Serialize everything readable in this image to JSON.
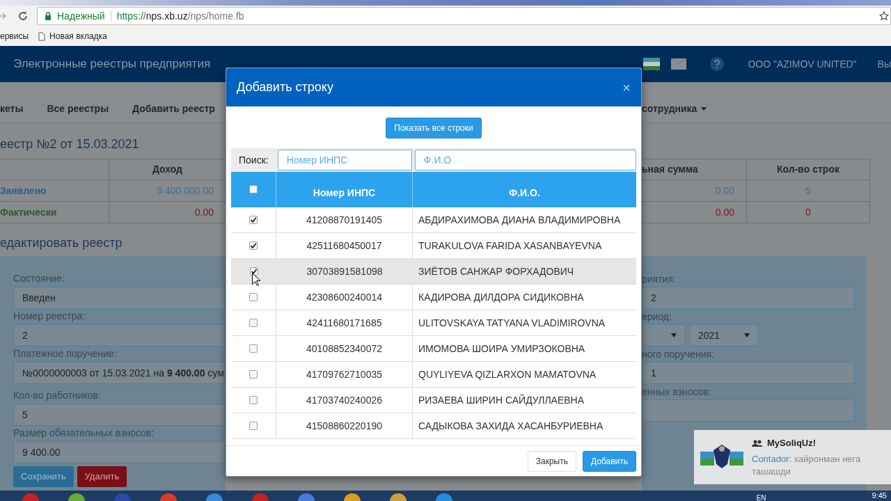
{
  "browser": {
    "security_label": "Надежный",
    "url_scheme": "https://",
    "url_host": "nps.xb.uz",
    "url_path": "/nps/home.fb",
    "bookmarks": [
      {
        "label": "ервисы",
        "kind": "folder"
      },
      {
        "label": "Новая вкладка",
        "kind": "page"
      }
    ]
  },
  "header": {
    "title": "Электронные реестры предприятия",
    "company": "ООО \"AZIMOV UNITED\"",
    "logout": "Вы"
  },
  "nav": {
    "left": [
      "кеты",
      "Все реестры",
      "Добавить реестр"
    ],
    "right": "сотрудника"
  },
  "registry_title": "еестр №2 от 15.03.2021",
  "summary": {
    "left_columns": [
      "",
      "Доход"
    ],
    "right_columns": [
      "ьная сумма",
      "Кол-во строк"
    ],
    "rows": [
      {
        "label": "Заявлено",
        "kind": "declared",
        "income": "9 400 000.00",
        "sum": "0.00",
        "count": "5"
      },
      {
        "label": "Фактически",
        "kind": "actual",
        "income": "0.00",
        "sum": "0.00",
        "count": "0"
      }
    ]
  },
  "edit_title": "едактировать реестр",
  "form_left": [
    {
      "label": "Состояние:",
      "value": "Введен"
    },
    {
      "label": "Номер реестра:",
      "value": "2"
    },
    {
      "label": "Платежное поручение:",
      "value": "№0000000003 от 15.03.2021 на **9 400.00** сум"
    },
    {
      "label": "Кол-во работников:",
      "value": "5"
    },
    {
      "label": "Размер обязательных взносов:",
      "value": "9 400.00"
    }
  ],
  "form_right": [
    {
      "label": "риятия:",
      "kind": "text",
      "value": "2"
    },
    {
      "label": "ериод:",
      "kind": "selects",
      "year": "2021"
    },
    {
      "label": "ного поручения:",
      "kind": "text",
      "value": "1"
    },
    {
      "label": "енных взносов:",
      "kind": "text"
    }
  ],
  "form_buttons": [
    {
      "label": "Сохранить",
      "kind": "primary"
    },
    {
      "label": "Удалить",
      "kind": "danger"
    }
  ],
  "modal": {
    "title": "Добавить строку",
    "close": "×",
    "show_all": "Показать все строки",
    "search_label": "Поиск:",
    "search_inps_placeholder": "Номер ИНПС",
    "search_name_placeholder": "Ф.И.О",
    "columns": [
      "Номер ИНПС",
      "Ф.И.О."
    ],
    "all_checked": false,
    "rows": [
      {
        "inps": "41208870191405",
        "name": "АБДИРАХИМОВА ДИАНА ВЛАДИМИРОВНА",
        "checked": true,
        "hovered": false
      },
      {
        "inps": "42511680450017",
        "name": "TURAKULOVA FARIDA XASANBAYEVNA",
        "checked": true,
        "hovered": false
      },
      {
        "inps": "30703891581098",
        "name": "ЗИЁТОВ САНЖАР ФОРХАДОВИЧ",
        "checked": true,
        "hovered": true
      },
      {
        "inps": "42308600240014",
        "name": "КАДИРОВА ДИЛДОРА СИДИКОВНА",
        "checked": false,
        "hovered": false
      },
      {
        "inps": "42411680171685",
        "name": "ULITOVSKAYA TATYANA VLADIMIROVNA",
        "checked": false,
        "hovered": false
      },
      {
        "inps": "40108852340072",
        "name": "ИМОМОВА ШОИРА УМИРЗОКОВНА",
        "checked": false,
        "hovered": false
      },
      {
        "inps": "41709762710035",
        "name": "QUYLIYEVA QIZLARXON MAMATOVNA",
        "checked": false,
        "hovered": false
      },
      {
        "inps": "41703740240026",
        "name": "РИЗАЕВА ШИРИН САЙДУЛЛАЕВНА",
        "checked": false,
        "hovered": false
      },
      {
        "inps": "41508860220190",
        "name": "САДЫКОВА ЗАХИДА ХАСАНБУРИЕВНА",
        "checked": false,
        "hovered": false
      }
    ],
    "buttons": [
      {
        "label": "Закрыть",
        "kind": "default"
      },
      {
        "label": "Добавить",
        "kind": "primary"
      }
    ]
  },
  "notification": {
    "title": "MySoliqUz!",
    "sender": "Contador:",
    "message": "хайронман нега ташашди"
  },
  "taskbar": {
    "language": "EN",
    "time": "9:45"
  }
}
